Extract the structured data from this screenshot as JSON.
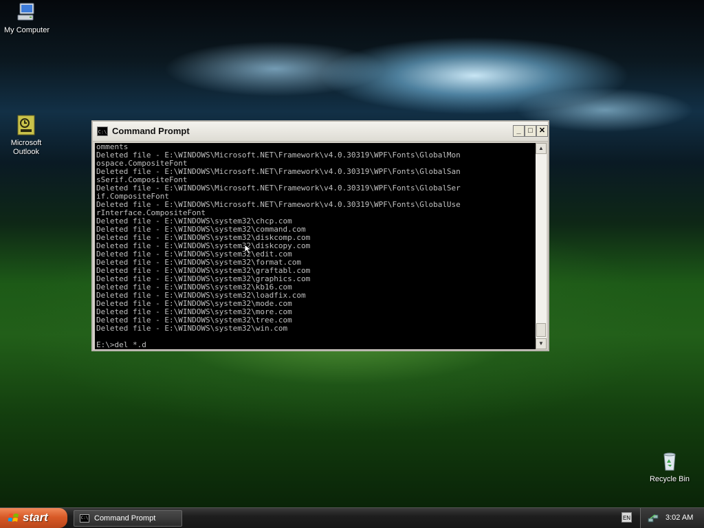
{
  "desktop": {
    "icons": {
      "my_computer": "My Computer",
      "outlook_line1": "Microsoft",
      "outlook_line2": "Outlook",
      "recycle_bin": "Recycle Bin"
    }
  },
  "window": {
    "title": "Command Prompt",
    "icon_glyph": "C:\\",
    "buttons": {
      "minimize": "_",
      "maximize": "□",
      "close": "✕"
    },
    "scroll_up": "▲",
    "scroll_down": "▼",
    "console_lines": [
      "omments",
      "Deleted file - E:\\WINDOWS\\Microsoft.NET\\Framework\\v4.0.30319\\WPF\\Fonts\\GlobalMon",
      "ospace.CompositeFont",
      "Deleted file - E:\\WINDOWS\\Microsoft.NET\\Framework\\v4.0.30319\\WPF\\Fonts\\GlobalSan",
      "sSerif.CompositeFont",
      "Deleted file - E:\\WINDOWS\\Microsoft.NET\\Framework\\v4.0.30319\\WPF\\Fonts\\GlobalSer",
      "if.CompositeFont",
      "Deleted file - E:\\WINDOWS\\Microsoft.NET\\Framework\\v4.0.30319\\WPF\\Fonts\\GlobalUse",
      "rInterface.CompositeFont",
      "Deleted file - E:\\WINDOWS\\system32\\chcp.com",
      "Deleted file - E:\\WINDOWS\\system32\\command.com",
      "Deleted file - E:\\WINDOWS\\system32\\diskcomp.com",
      "Deleted file - E:\\WINDOWS\\system32\\diskcopy.com",
      "Deleted file - E:\\WINDOWS\\system32\\edit.com",
      "Deleted file - E:\\WINDOWS\\system32\\format.com",
      "Deleted file - E:\\WINDOWS\\system32\\graftabl.com",
      "Deleted file - E:\\WINDOWS\\system32\\graphics.com",
      "Deleted file - E:\\WINDOWS\\system32\\kb16.com",
      "Deleted file - E:\\WINDOWS\\system32\\loadfix.com",
      "Deleted file - E:\\WINDOWS\\system32\\mode.com",
      "Deleted file - E:\\WINDOWS\\system32\\more.com",
      "Deleted file - E:\\WINDOWS\\system32\\tree.com",
      "Deleted file - E:\\WINDOWS\\system32\\win.com",
      "",
      "E:\\>del *.d"
    ]
  },
  "taskbar": {
    "start_label": "start",
    "task_item": "Command Prompt",
    "language": "EN",
    "clock": "3:02 AM"
  },
  "colors": {
    "console_bg": "#000000",
    "console_text": "#c0c0c0",
    "start_button": "#d85a27"
  }
}
